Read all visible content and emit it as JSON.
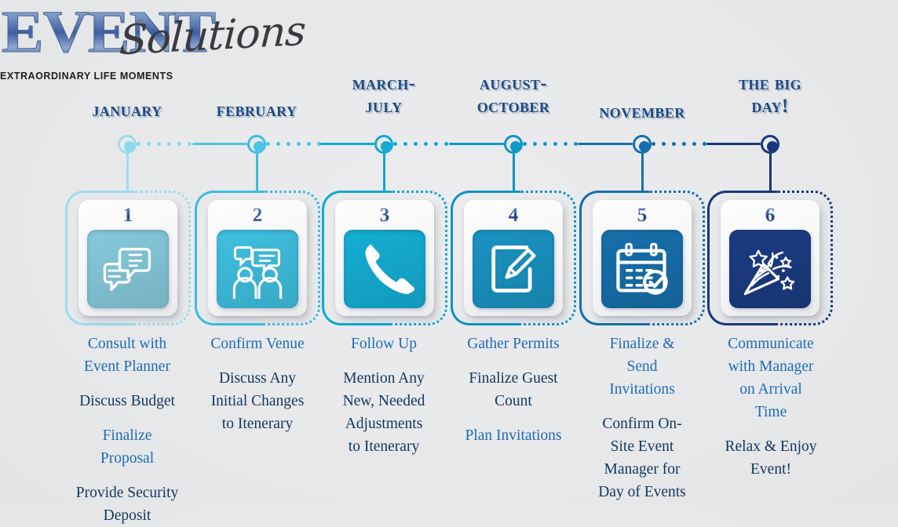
{
  "logo": {
    "word_main": "EVENT",
    "word_script": "Solutions",
    "tagline": "EXTRAORDINARY LIFE MOMENTS"
  },
  "colors": {
    "background": "#e8e9eb",
    "header_text": "#1b4a85",
    "text_blue": "#1e6bb8",
    "text_navy": "#13365e",
    "stage1": "#9ddced",
    "stage2": "#4cc4e4",
    "stage3": "#0fabd2",
    "stage4": "#0d9ac8",
    "stage5": "#1470ad",
    "stage6": "#17387c"
  },
  "timeline": {
    "headers": [
      {
        "lines": [
          "January"
        ]
      },
      {
        "lines": [
          "February"
        ]
      },
      {
        "lines": [
          "March-",
          "July"
        ]
      },
      {
        "lines": [
          "august-",
          "October"
        ]
      },
      {
        "lines": [
          "November"
        ]
      },
      {
        "lines": [
          "The big",
          "day!"
        ]
      }
    ]
  },
  "steps": [
    {
      "number": "1",
      "icon": "chat-bubbles-icon",
      "accent": "#86cadd",
      "frame": "#9ddced",
      "node": "#8ed8ec",
      "ring": "#9ddced",
      "text": [
        {
          "value": "Consult with",
          "tone": "blue"
        },
        {
          "value": "Event Planner",
          "tone": "blue"
        },
        {
          "value": "",
          "tone": "gap"
        },
        {
          "value": "Discuss Budget",
          "tone": "navy"
        },
        {
          "value": "",
          "tone": "gap"
        },
        {
          "value": "Finalize",
          "tone": "blue"
        },
        {
          "value": "Proposal",
          "tone": "blue"
        },
        {
          "value": "",
          "tone": "gap"
        },
        {
          "value": "Provide Security",
          "tone": "navy"
        },
        {
          "value": "Deposit",
          "tone": "navy"
        }
      ]
    },
    {
      "number": "2",
      "icon": "people-talking-icon",
      "accent": "#3fc0e0",
      "frame": "#3bbde0",
      "node": "#4cc4e4",
      "ring": "#3bbde0",
      "text": [
        {
          "value": "Confirm Venue",
          "tone": "blue"
        },
        {
          "value": "",
          "tone": "gap"
        },
        {
          "value": "Discuss Any",
          "tone": "navy"
        },
        {
          "value": "Initial Changes",
          "tone": "navy"
        },
        {
          "value": "to Itenerary",
          "tone": "navy"
        }
      ]
    },
    {
      "number": "3",
      "icon": "phone-handset-icon",
      "accent": "#15aed4",
      "frame": "#10a8d2",
      "node": "#0fabd2",
      "ring": "#10a8d2",
      "text": [
        {
          "value": "Follow Up",
          "tone": "blue"
        },
        {
          "value": "",
          "tone": "gap"
        },
        {
          "value": "Mention Any",
          "tone": "navy"
        },
        {
          "value": "New, Needed",
          "tone": "navy"
        },
        {
          "value": "Adjustments",
          "tone": "navy"
        },
        {
          "value": "to Itenerary",
          "tone": "navy"
        }
      ]
    },
    {
      "number": "4",
      "icon": "edit-pencil-icon",
      "accent": "#1a93c2",
      "frame": "#0f94c4",
      "node": "#0d9ac8",
      "ring": "#0f94c4",
      "text": [
        {
          "value": "Gather Permits",
          "tone": "blue"
        },
        {
          "value": "",
          "tone": "gap"
        },
        {
          "value": "Finalize Guest",
          "tone": "navy"
        },
        {
          "value": "Count",
          "tone": "navy"
        },
        {
          "value": "",
          "tone": "gap"
        },
        {
          "value": "Plan Invitations",
          "tone": "blue"
        }
      ]
    },
    {
      "number": "5",
      "icon": "calendar-check-icon",
      "accent": "#176fab",
      "frame": "#1470ad",
      "node": "#1470ad",
      "ring": "#1470ad",
      "text": [
        {
          "value": "Finalize &",
          "tone": "blue"
        },
        {
          "value": "Send",
          "tone": "blue"
        },
        {
          "value": "Invitations",
          "tone": "blue"
        },
        {
          "value": "",
          "tone": "gap"
        },
        {
          "value": "Confirm On-",
          "tone": "navy"
        },
        {
          "value": "Site Event",
          "tone": "navy"
        },
        {
          "value": "Manager for",
          "tone": "navy"
        },
        {
          "value": "Day of Events",
          "tone": "navy"
        }
      ]
    },
    {
      "number": "6",
      "icon": "party-popper-icon",
      "accent": "#1b3b82",
      "frame": "#17387c",
      "node": "#17387c",
      "ring": "#17387c",
      "text": [
        {
          "value": "Communicate",
          "tone": "blue"
        },
        {
          "value": "with Manager",
          "tone": "blue"
        },
        {
          "value": "on Arrival",
          "tone": "blue"
        },
        {
          "value": "Time",
          "tone": "blue"
        },
        {
          "value": "",
          "tone": "gap"
        },
        {
          "value": "Relax & Enjoy",
          "tone": "navy"
        },
        {
          "value": "Event!",
          "tone": "navy"
        }
      ]
    }
  ]
}
